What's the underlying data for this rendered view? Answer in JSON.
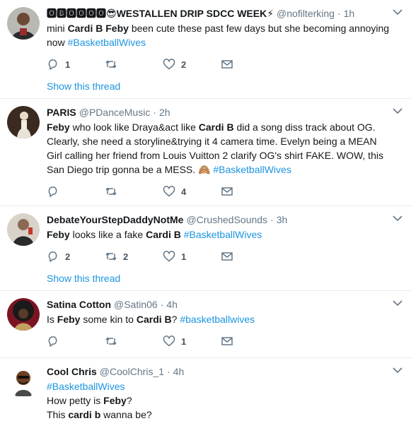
{
  "tweets": [
    {
      "name": "🅾🅱🅾🅾🅾🅾😎WESTALLEN DRIP SDCC WEEK⚡",
      "handle": "@nofilterking",
      "dot": "·",
      "time": "1h",
      "text": {
        "p1": "mini ",
        "b1": "Cardi B",
        "p2": " ",
        "b2": "Feby",
        "p3": " been cute these past few days but she becoming annoying now ",
        "h1": "#BasketballWives"
      },
      "reply_count": "1",
      "retweet_count": "",
      "like_count": "2",
      "thread_label": "Show this thread"
    },
    {
      "name": "PARIS",
      "handle": "@PDanceMusic",
      "dot": "·",
      "time": "2h",
      "text": {
        "b1": "Feby",
        "p1": " who look like Draya&act like ",
        "b2": "Cardi B",
        "p2": " did a song diss track about OG. Clearly, she need a storyline&trying it 4 camera time. Evelyn being a MEAN Girl calling her friend from Louis Vuitton 2 clarify OG's shirt FAKE. WOW, this San Diego trip gonna be a MESS. 🙈 ",
        "h1": "#BasketballWives"
      },
      "reply_count": "",
      "retweet_count": "",
      "like_count": "4"
    },
    {
      "name": "DebateYourStepDaddyNotMe",
      "handle": "@CrushedSounds",
      "dot": "·",
      "time": "3h",
      "text": {
        "b1": "Feby",
        "p1": " looks like a fake ",
        "b2": "Cardi B",
        "p2": " ",
        "h1": "#BasketballWives"
      },
      "reply_count": "2",
      "retweet_count": "2",
      "like_count": "1",
      "thread_label": "Show this thread"
    },
    {
      "name": "Satina Cotton",
      "handle": "@Satin06",
      "dot": "·",
      "time": "4h",
      "text": {
        "p1": "Is ",
        "b1": "Feby",
        "p2": " some kin to ",
        "b2": "Cardi B",
        "p3": "? ",
        "h1": "#basketballwives"
      },
      "reply_count": "",
      "retweet_count": "",
      "like_count": "1"
    },
    {
      "name": "Cool Chris",
      "handle": "@CoolChris_1",
      "dot": "·",
      "time": "4h",
      "text": {
        "h1": "#BasketballWives",
        "p1": "How petty is ",
        "b1": "Feby",
        "p2": "?",
        "p3": "This ",
        "b2": "cardi b",
        "p4": " wanna be?"
      }
    }
  ],
  "colors": {
    "link": "#1b95e0",
    "muted": "#657786",
    "border": "#e6ecf0"
  },
  "icons": [
    "caret-down-icon",
    "reply-icon",
    "retweet-icon",
    "like-icon",
    "message-icon"
  ]
}
